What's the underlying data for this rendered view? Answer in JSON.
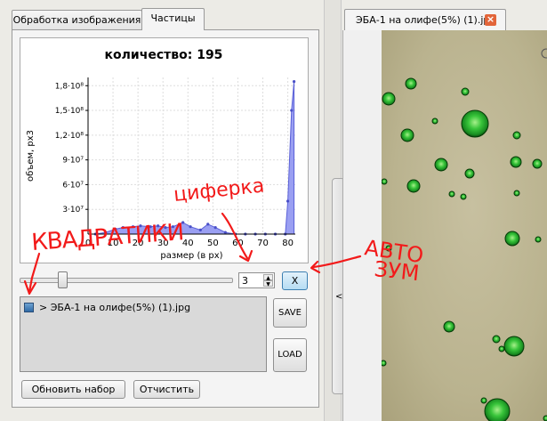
{
  "left_tabs": {
    "image_processing": "Обработка изображения",
    "particles": "Частицы"
  },
  "chart_data": {
    "type": "area",
    "title": "количество: 195",
    "xlabel": "размер (в px)",
    "ylabel": "объем, px3",
    "x_ticks": [
      "0",
      "10",
      "20",
      "30",
      "40",
      "50",
      "60",
      "70",
      "80"
    ],
    "y_ticks": [
      "3·10⁷",
      "6·10⁷",
      "9·10⁷",
      "1,2·10⁸",
      "1,5·10⁸",
      "1,8·10⁸"
    ],
    "xlim": [
      0,
      83
    ],
    "ylim": [
      0,
      190000000
    ],
    "grid": true,
    "color": "#9a9ff2",
    "x": [
      3,
      7,
      11,
      14,
      18,
      21,
      25,
      28,
      31,
      34,
      38,
      41,
      45,
      48,
      51,
      55,
      59,
      63,
      67,
      71,
      75,
      79,
      80,
      81.5,
      82.5
    ],
    "y": [
      0,
      2000000,
      6000000,
      8000000,
      9000000,
      10000000,
      9000000,
      10000000,
      8000000,
      9000000,
      14000000,
      9000000,
      5000000,
      12000000,
      8000000,
      2000000,
      0,
      0,
      0,
      0,
      0,
      0,
      40000000,
      150000000,
      185000000
    ]
  },
  "controls": {
    "spinner_value": "3",
    "x_button": "X"
  },
  "file_list": {
    "items": [
      {
        "label": "> ЭБА-1 на олифе(5%) (1).jpg"
      }
    ]
  },
  "buttons": {
    "save": "SAVE",
    "load": "LOAD",
    "refresh": "Обновить набор",
    "clear": "Отчистить"
  },
  "splitter": {
    "arrow": "<"
  },
  "image_tab": {
    "title": "ЭБА-1 на олифе(5%) (1).jpg",
    "close": "×"
  },
  "annotations": {
    "squares": "КВАДРАТИКИ",
    "digit": "циферка",
    "auto_zoom_1": "АВТО",
    "auto_zoom_2": "ЗУМ"
  }
}
